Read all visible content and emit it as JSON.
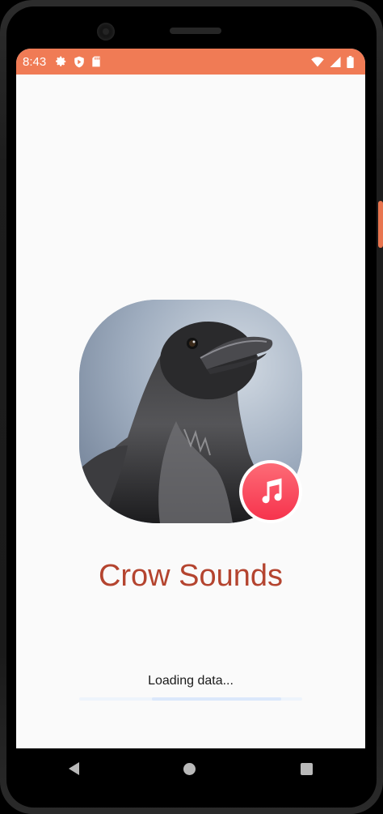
{
  "status_bar": {
    "time": "8:43",
    "left_icons": [
      "gear-icon",
      "shield-play-icon",
      "sd-card-icon"
    ],
    "right_icons": [
      "wifi-icon",
      "cell-signal-icon",
      "battery-icon"
    ],
    "color": "#f07b55"
  },
  "splash": {
    "title": "Crow Sounds",
    "loading_text": "Loading data...",
    "progress": 0.58,
    "title_color": "#b4442f"
  },
  "nav": {
    "icons": [
      "back-icon",
      "home-icon",
      "recents-icon"
    ]
  }
}
